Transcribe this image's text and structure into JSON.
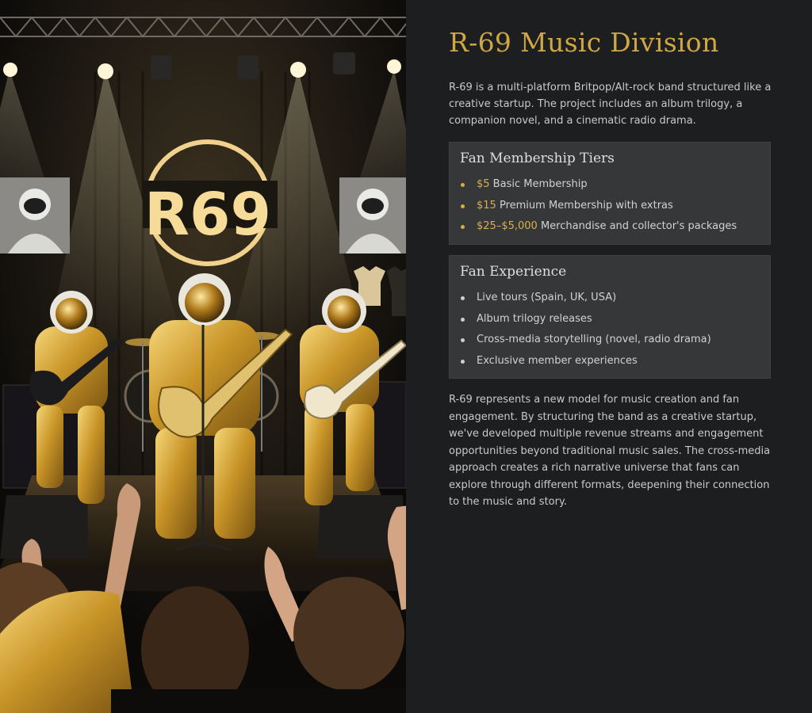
{
  "hero": {
    "logo_text": "R69",
    "alt": "Band of astronauts in gold suits performing on stage"
  },
  "panel": {
    "title": "R-69 Music Division",
    "intro": "R-69 is a multi-platform Britpop/Alt-rock band structured like a creative startup. The project includes an album trilogy, a companion novel, and a cinematic radio drama.",
    "tiers": {
      "heading": "Fan Membership Tiers",
      "items": [
        {
          "price": "$5",
          "text": " Basic Membership"
        },
        {
          "price": "$15",
          "text": " Premium Membership with extras"
        },
        {
          "price": "$25–$5,000",
          "text": " Merchandise and collector's packages"
        }
      ]
    },
    "experience": {
      "heading": "Fan Experience",
      "items": [
        "Live tours (Spain, UK, USA)",
        "Album trilogy releases",
        "Cross-media storytelling (novel, radio drama)",
        "Exclusive member experiences"
      ]
    },
    "outro": "R-69 represents a new model for music creation and fan engagement. By structuring the band as a creative startup, we've developed multiple revenue streams and engagement opportunities beyond traditional music sales. The cross-media approach creates a rich narrative universe that fans can explore through different formats, deepening their connection to the music and story."
  },
  "colors": {
    "gold": "#cfa743",
    "panel_bg": "#1d1e20",
    "card_bg": "#363739"
  },
  "icons": [
    "astronaut-poster-icon",
    "guitar-icon",
    "spotlight-icon"
  ]
}
